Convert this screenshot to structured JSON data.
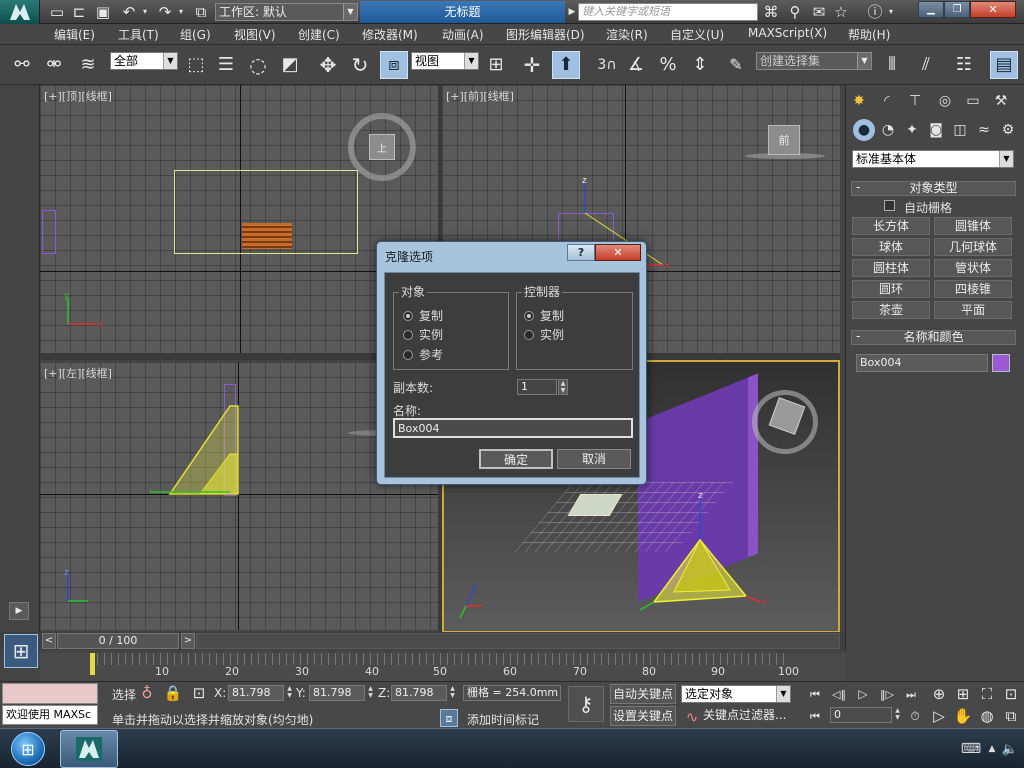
{
  "titlebar": {
    "workspace_label": "工作区: 默认",
    "doc_title": "无标题",
    "search_placeholder": "键入关键字或短语"
  },
  "menu": [
    "编辑(E)",
    "工具(T)",
    "组(G)",
    "视图(V)",
    "创建(C)",
    "修改器(M)",
    "动画(A)",
    "图形编辑器(D)",
    "渲染(R)",
    "自定义(U)",
    "MAXScript(X)",
    "帮助(H)"
  ],
  "toolbar": {
    "filter_value": "全部",
    "refcoord_value": "视图",
    "snap_label": "3",
    "selection_set_placeholder": "创建选择集"
  },
  "viewports": {
    "top_label": "[+][顶][线框]",
    "front_label": "[+][前][线框]",
    "left_label": "[+][左][线框]",
    "top_cube": "上",
    "front_cube": "前"
  },
  "axes": {
    "x": "x",
    "y": "y",
    "z": "z"
  },
  "command_panel": {
    "category_value": "标准基本体",
    "object_type_header": "对象类型",
    "autogrid_label": "自动栅格",
    "buttons": [
      "长方体",
      "圆锥体",
      "球体",
      "几何球体",
      "圆柱体",
      "管状体",
      "圆环",
      "四棱锥",
      "茶壶",
      "平面"
    ],
    "name_color_header": "名称和颜色",
    "name_value": "Box004",
    "object_color": "#9b59d6"
  },
  "dialog": {
    "title": "克隆选项",
    "object_group": "对象",
    "object_options": [
      "复制",
      "实例",
      "参考"
    ],
    "controller_group": "控制器",
    "controller_options": [
      "复制",
      "实例"
    ],
    "copies_label": "副本数:",
    "copies_value": "1",
    "name_label": "名称:",
    "name_value": "Box004",
    "ok_label": "确定",
    "cancel_label": "取消"
  },
  "timeline": {
    "frame_display": "0 / 100",
    "ticks": [
      "10",
      "20",
      "30",
      "40",
      "50",
      "60",
      "70",
      "80",
      "90",
      "100"
    ]
  },
  "status": {
    "welcome_text": "欢迎使用 MAXSc",
    "select_label": "选择",
    "x_label": "X:",
    "x_value": "81.798",
    "y_label": "Y:",
    "y_value": "81.798",
    "z_label": "Z:",
    "z_value": "81.798",
    "grid_text": "栅格 = 254.0mm",
    "prompt_text": "单击并拖动以选择并缩放对象(均匀地)",
    "add_time_tag": "添加时间标记",
    "auto_key": "自动关键点",
    "set_key": "设置关键点",
    "key_mode_value": "选定对象",
    "key_filters": "关键点过滤器...",
    "current_frame": "0"
  }
}
